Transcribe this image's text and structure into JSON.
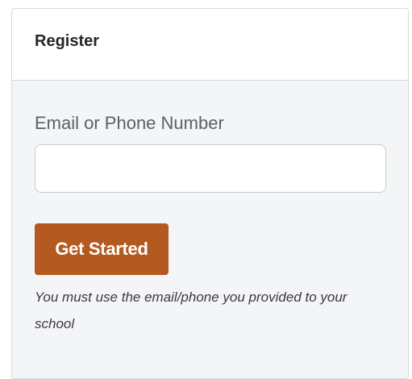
{
  "register_card": {
    "title": "Register",
    "email_label": "Email or Phone Number",
    "email_value": "",
    "email_placeholder": "",
    "submit_label": "Get Started",
    "help_text": "You must use the email/phone you provided to your school"
  },
  "colors": {
    "accent": "#b45a20",
    "card_background": "#f3f5f6",
    "border": "#d6d9db"
  }
}
